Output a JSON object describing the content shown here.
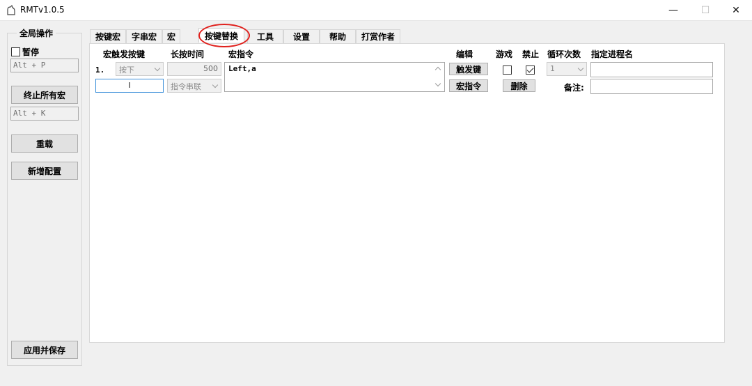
{
  "window": {
    "title": "RMTv1.0.5",
    "minimize_glyph": "—",
    "maximize_glyph": "☐",
    "close_glyph": "✕"
  },
  "sidebar": {
    "title": "全局操作",
    "pause_label": "暂停",
    "pause_checked": false,
    "pause_hotkey": "Alt + P",
    "stop_all_button": "终止所有宏",
    "stop_hotkey": "Alt + K",
    "reload_button": "重载",
    "add_config_button": "新增配置",
    "apply_save_button": "应用并保存"
  },
  "tabs": [
    {
      "label": "按键宏",
      "active": false
    },
    {
      "label": "字串宏",
      "active": false
    },
    {
      "label": "宏",
      "active": false
    },
    {
      "label": "按键替换",
      "active": true
    },
    {
      "label": "工具",
      "active": false
    },
    {
      "label": "设置",
      "active": false
    },
    {
      "label": "帮助",
      "active": false
    },
    {
      "label": "打赏作者",
      "active": false
    }
  ],
  "columns": {
    "trigger_key": "宏触发按键",
    "hold_time": "长按时间",
    "macro_command": "宏指令",
    "edit": "编辑",
    "game": "游戏",
    "disable": "禁止",
    "loop_count": "循环次数",
    "process_name": "指定进程名"
  },
  "row": {
    "index": "1.",
    "trigger_mode": "按下",
    "trigger_key_value": "l",
    "hold_time_value": "500",
    "command_mode": "指令串联",
    "command_text": "Left,a",
    "trigger_key_button": "触发键",
    "macro_command_button": "宏指令",
    "delete_button": "删除",
    "game_checked": false,
    "disable_checked": true,
    "loop_count_value": "1",
    "process_name_value": "",
    "remark_label": "备注:",
    "remark_value": ""
  },
  "colors": {
    "highlight_ring": "#e0201c"
  }
}
